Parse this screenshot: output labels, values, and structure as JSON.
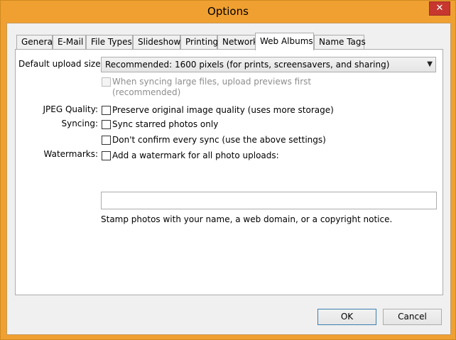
{
  "window": {
    "title": "Options",
    "close_glyph": "✕"
  },
  "tabs": [
    {
      "label": "General"
    },
    {
      "label": "E-Mail"
    },
    {
      "label": "File Types"
    },
    {
      "label": "Slideshow"
    },
    {
      "label": "Printing"
    },
    {
      "label": "Network"
    },
    {
      "label": "Web Albums",
      "active": true
    },
    {
      "label": "Name Tags"
    }
  ],
  "upload_size": {
    "label": "Default upload size:",
    "selected": "Recommended: 1600 pixels (for prints, screensavers, and sharing)"
  },
  "previews": {
    "label_line1": "When syncing large files, upload previews first",
    "label_line2": "(recommended)",
    "checked": false,
    "disabled": true
  },
  "jpeg_quality": {
    "label": "JPEG Quality:",
    "option": "Preserve original image quality (uses more storage)",
    "checked": false
  },
  "syncing": {
    "label": "Syncing:",
    "option1": "Sync starred photos only",
    "option2": "Don't confirm every sync (use the above settings)",
    "checked1": false,
    "checked2": false
  },
  "watermarks": {
    "label": "Watermarks:",
    "option": "Add a watermark for all photo uploads:",
    "checked": false,
    "text_value": "",
    "help": "Stamp photos with your name, a web domain, or a copyright notice."
  },
  "buttons": {
    "ok": "OK",
    "cancel": "Cancel"
  }
}
